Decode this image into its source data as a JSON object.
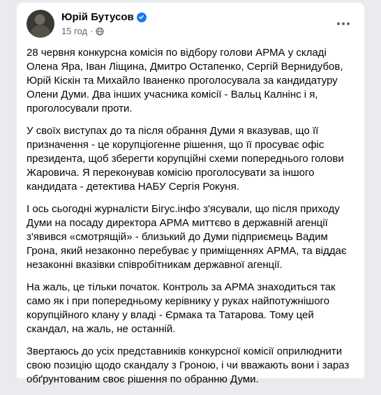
{
  "post": {
    "author": "Юрій Бутусов",
    "time": "15 год",
    "separator": "·",
    "verified_icon": "verified-badge-icon",
    "privacy_icon": "globe-icon",
    "more_icon": "more-options-icon",
    "paragraphs": [
      "28 червня конкурсна комісія по відбору голови АРМА у складі\nОлена Яра, Іван Ліщина, Дмитро Остапенко, Сергій Вернидубов,\nЮрій Кіскін та Михайло Іваненко проголосувала за кандидатуру\nОлени Думи. Два інших учасника комісії - Вальц Калнінс і я,\nпроголосували проти.",
      "У своїх виступах до та після обрання Думи я вказував, що її\nпризначення - це корупціогенне рішення, що її просуває офіс\nпрезидента, щоб зберегти корупційні схеми попереднього голови\nЖаровича. Я переконував комісію проголосувати за іншого\nкандидата - детектива НАБУ Сергія Рокуня.",
      "І ось сьогодні журналісти Бігус.інфо з'ясували, що після приходу\nДуми на посаду директора АРМА миттєво в державній агенції\nз'явився «смотрящій» - близький до Думи підприємець Вадим\nГрона, який незаконно перебуває у приміщеннях АРМА, та віддає\nнезаконні вказівки співробітникам державної агенції.",
      "На жаль, це тільки початок. Контроль за АРМА знаходиться так\nсамо як і при попередньому керівнику у руках найпотужнішого\nкорупційного клану у владі - Єрмака та Татарова. Тому цей\nскандал, на жаль, не останній.",
      "Звертаюсь до усіх представників конкурсної комісії оприлюднити\nсвою позицію щодо скандалу з Гроною, і чи вважають вони і зараз\nобґрунтованим своє рішення по обранню Думи."
    ]
  }
}
